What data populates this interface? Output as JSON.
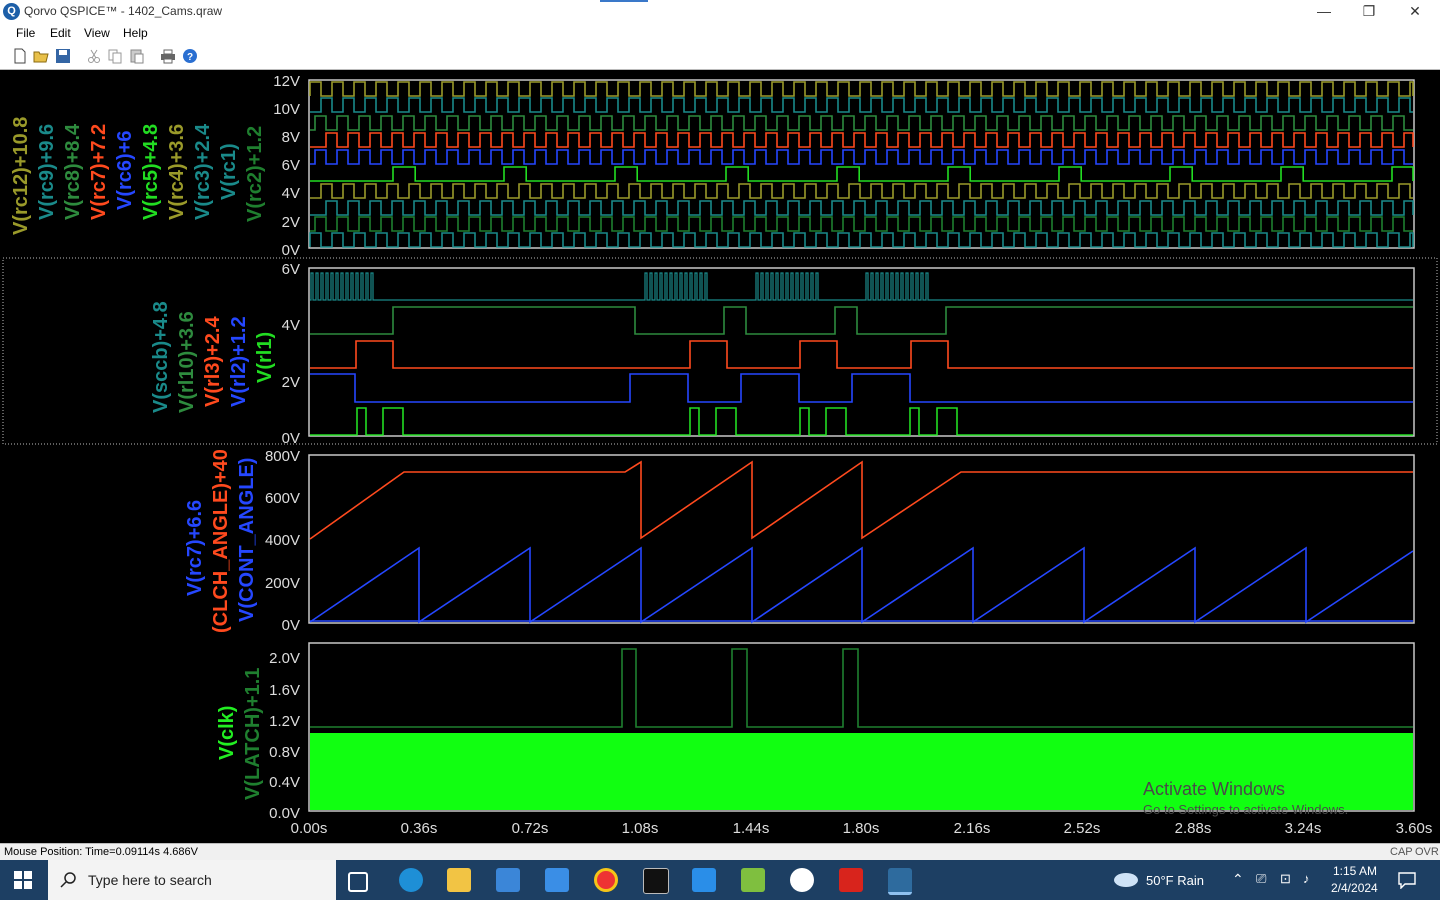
{
  "window": {
    "title": "Qorvo QSPICE™ - 1402_Cams.qraw",
    "minimize_glyph": "—",
    "maximize_glyph": "❐",
    "close_glyph": "✕"
  },
  "menu": [
    "File",
    "Edit",
    "View",
    "Help"
  ],
  "toolbar_icons": [
    "new-file-icon",
    "open-folder-icon",
    "save-icon",
    "cut-icon",
    "copy-icon",
    "paste-icon",
    "print-icon",
    "help-icon"
  ],
  "panes": [
    {
      "y_ticks": [
        "12V",
        "10V",
        "8V",
        "6V",
        "4V",
        "2V",
        "0V"
      ],
      "traces": [
        {
          "label": "V(rc12)+10.8",
          "color": "#9a9a2a"
        },
        {
          "label": "V(rc9)+9.6",
          "color": "#1a8a8a"
        },
        {
          "label": "V(rc8)+8.4",
          "color": "#2e8b3e"
        },
        {
          "label": "V(rc7)+7.2",
          "color": "#ff4a1e"
        },
        {
          "label": "V(rc6)+6",
          "color": "#2547ff"
        },
        {
          "label": "V(rc5)+4.8",
          "color": "#22dd22"
        },
        {
          "label": "V(rc4)+3.6",
          "color": "#9a9a2a"
        },
        {
          "label": "V(rc3)+2.4",
          "color": "#1a8a8a"
        },
        {
          "label": "V(rc1)",
          "color": "#1a8a8a"
        },
        {
          "label": "V(rc2)+1.2",
          "color": "#1f7f2f"
        }
      ]
    },
    {
      "y_ticks": [
        "6V",
        "4V",
        "2V",
        "0V"
      ],
      "traces": [
        {
          "label": "V(sccb)+4.8",
          "color": "#1a8a8a"
        },
        {
          "label": "V(rl10)+3.6",
          "color": "#2e8b3e"
        },
        {
          "label": "V(rl3)+2.4",
          "color": "#ff4a1e"
        },
        {
          "label": "V(rl2)+1.2",
          "color": "#2547ff"
        },
        {
          "label": "V(rl1)",
          "color": "#22dd22"
        }
      ]
    },
    {
      "y_ticks": [
        "800V",
        "600V",
        "400V",
        "200V",
        "0V"
      ],
      "traces": [
        {
          "label": "V(rc7)+6.6",
          "color": "#2547ff"
        },
        {
          "label": "(CLCH_ANGLE)+40",
          "color": "#ff4a1e"
        },
        {
          "label": "V(CONT_ANGLE)",
          "color": "#2547ff"
        }
      ]
    },
    {
      "y_ticks": [
        "2.0V",
        "1.6V",
        "1.2V",
        "0.8V",
        "0.4V",
        "0.0V"
      ],
      "traces": [
        {
          "label": "V(clk)",
          "color": "#22ee22"
        },
        {
          "label": "V(LATCH)+1.1",
          "color": "#1f7f2f"
        }
      ]
    }
  ],
  "x_ticks": [
    "0.00s",
    "0.36s",
    "0.72s",
    "1.08s",
    "1.44s",
    "1.80s",
    "2.16s",
    "2.52s",
    "2.88s",
    "3.24s",
    "3.60s"
  ],
  "watermark": {
    "line1": "Activate Windows",
    "line2": "Go to Settings to activate Windows."
  },
  "status": {
    "mouse": "Mouse Position: Time=0.09114s  4.686V",
    "cap": "CAP",
    "ovr": "OVR"
  },
  "taskbar": {
    "search_placeholder": "Type here to search",
    "weather": "50°F  Rain",
    "time": "1:15 AM",
    "date": "2/4/2024",
    "icons": [
      "task-view-icon",
      "edge-icon",
      "file-explorer-icon",
      "store-icon",
      "mail-icon",
      "chrome-icon",
      "terminal-icon",
      "vscode-icon",
      "notepad-icon",
      "qspice-icon",
      "acrobat-icon",
      "app-icon"
    ]
  }
}
